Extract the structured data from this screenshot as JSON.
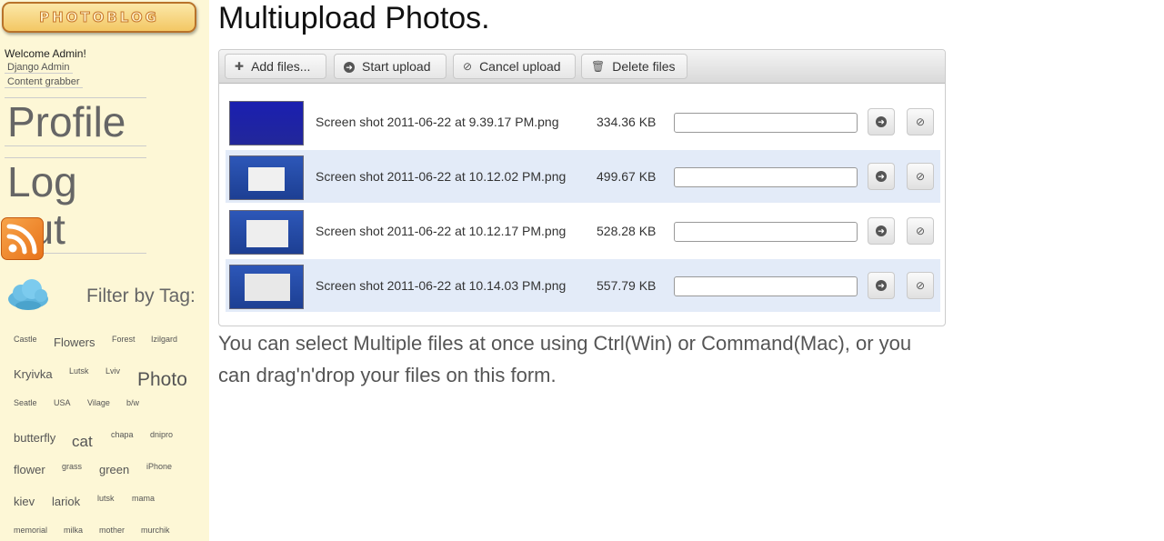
{
  "sidebar": {
    "logo_text": "PHOTOBLOG",
    "welcome": "Welcome Admin!",
    "admin_links": [
      "Django Admin",
      "Content grabber"
    ],
    "profile_label": "Profile",
    "logout_label": "Log out",
    "filter_title": "Filter by Tag:",
    "tags": [
      "Castle",
      "Flowers",
      "Forest",
      "Izilgard",
      "Kryivka",
      "Lutsk",
      "Lviv",
      "Photo",
      "Seatle",
      "USA",
      "Vilage",
      "b/w",
      "butterfly",
      "cat",
      "chapa",
      "dnipro",
      "flower",
      "grass",
      "green",
      "iPhone",
      "kiev",
      "lariok",
      "lutsk",
      "mama",
      "memorial",
      "milka",
      "mother",
      "murchik"
    ]
  },
  "main": {
    "title": "Multiupload Photos.",
    "toolbar": {
      "add_files": "Add files...",
      "start_upload": "Start upload",
      "cancel_upload": "Cancel upload",
      "delete_files": "Delete files"
    },
    "files": [
      {
        "name": "Screen shot 2011-06-22 at 9.39.17 PM.png",
        "size": "334.36 KB",
        "progress": 0
      },
      {
        "name": "Screen shot 2011-06-22 at 10.12.02 PM.png",
        "size": "499.67 KB",
        "progress": 0
      },
      {
        "name": "Screen shot 2011-06-22 at 10.12.17 PM.png",
        "size": "528.28 KB",
        "progress": 0
      },
      {
        "name": "Screen shot 2011-06-22 at 10.14.03 PM.png",
        "size": "557.79 KB",
        "progress": 0
      }
    ],
    "help_text": "You can select Multiple files at once using Ctrl(Win) or Command(Mac), or you can drag'n'drop your files on this form."
  },
  "colors": {
    "sidebar_bg": "#fdf7d6",
    "alt_row_bg": "#e3ebf8",
    "rss_orange": "#e8731a"
  }
}
